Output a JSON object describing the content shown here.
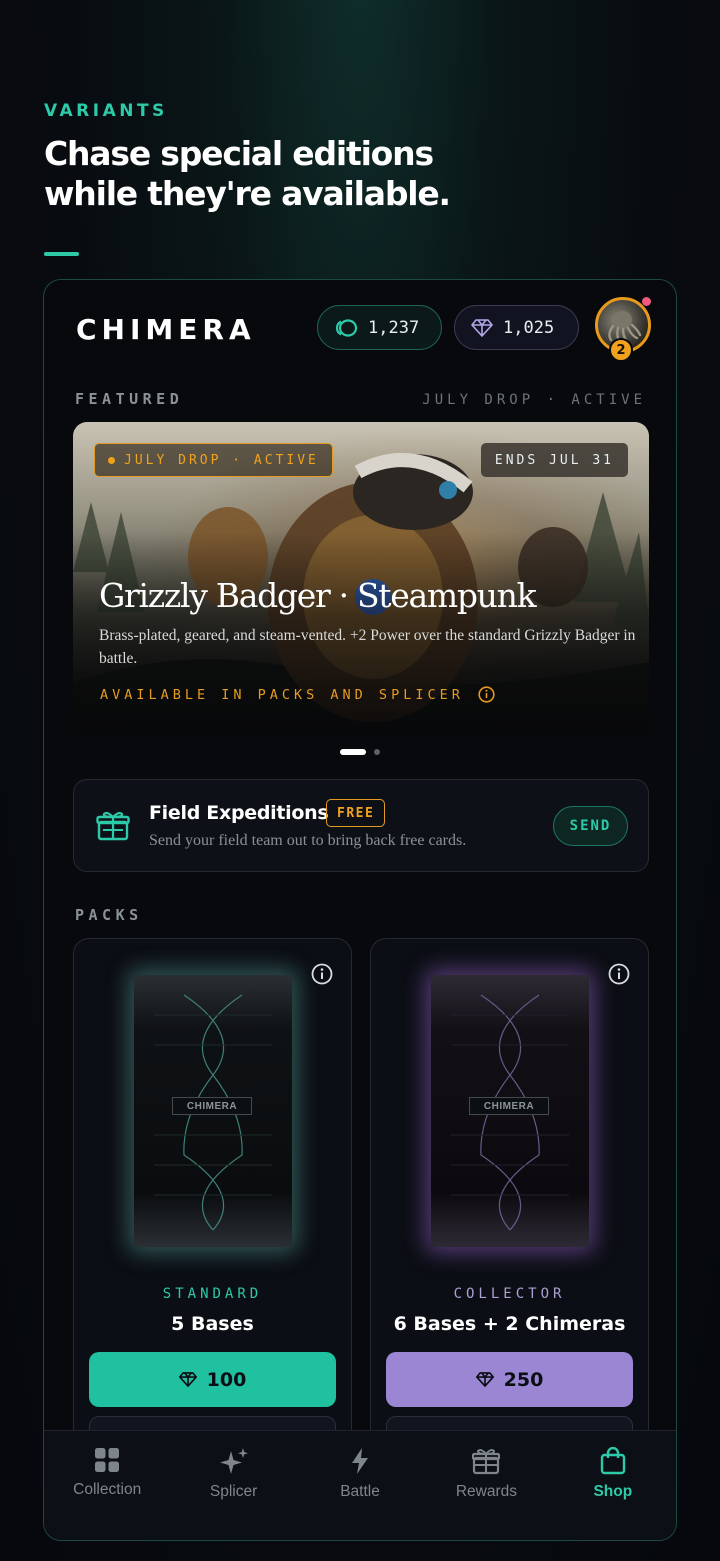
{
  "header": {
    "eyebrow": "VARIANTS",
    "headline_line1": "Chase special editions",
    "headline_line2": "while they're available."
  },
  "app": {
    "brand": "CHIMERA",
    "coins": "1,237",
    "gems": "1,025",
    "avatar_level": "2"
  },
  "featured": {
    "label": "FEATURED",
    "meta": "JULY DROP · ACTIVE",
    "hero": {
      "tag": "JULY DROP · ACTIVE",
      "ends": "ENDS JUL 31",
      "title": "Grizzly Badger · Steampunk",
      "description": "Brass-plated, geared, and steam-vented. +2 Power over the standard Grizzly Badger in battle.",
      "availability": "AVAILABLE IN PACKS AND SPLICER"
    }
  },
  "expedition": {
    "title": "Field Expeditions",
    "badge": "FREE",
    "subtitle": "Send your field team out to bring back free cards.",
    "action": "SEND"
  },
  "packs": {
    "label": "PACKS",
    "items": [
      {
        "type": "STANDARD",
        "contents": "5 Bases",
        "price": "100",
        "pack_logo": "CHIMERA"
      },
      {
        "type": "COLLECTOR",
        "contents": "6 Bases + 2 Chimeras",
        "price": "250",
        "pack_logo": "CHIMERA"
      }
    ]
  },
  "tabs": [
    {
      "label": "Collection",
      "icon": "grid-icon"
    },
    {
      "label": "Splicer",
      "icon": "sparkle-icon"
    },
    {
      "label": "Battle",
      "icon": "lightning-icon"
    },
    {
      "label": "Rewards",
      "icon": "gift-icon"
    },
    {
      "label": "Shop",
      "icon": "shopping-bag-icon",
      "active": true
    }
  ],
  "colors": {
    "accent": "#2ccaa8",
    "warning": "#f0a21c",
    "collector": "#9a86d2"
  }
}
